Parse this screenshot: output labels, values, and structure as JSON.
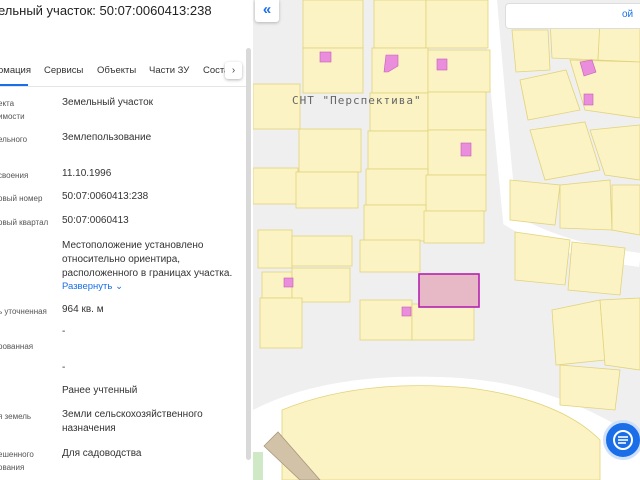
{
  "panel": {
    "title": "ельный участок: 50:07:0060413:238",
    "tabs": [
      {
        "label": "омация"
      },
      {
        "label": "Сервисы"
      },
      {
        "label": "Объекты"
      },
      {
        "label": "Части ЗУ"
      },
      {
        "label": "Соста"
      }
    ],
    "next_icon": "chevron-right-icon",
    "rows": [
      {
        "label": [
          "екта",
          "имости"
        ],
        "value": "Земельный участок"
      },
      {
        "label": [
          "ельного"
        ],
        "value": "Землепользование"
      },
      {
        "label": [
          "своения"
        ],
        "value": "11.10.1996"
      },
      {
        "label": [
          "овый номер"
        ],
        "value": "50:07:0060413:238"
      },
      {
        "label": [
          "овый квартал"
        ],
        "value": "50:07:0060413"
      },
      {
        "label": [],
        "value": "Местоположение установлено относительно ориентира, расположенного в границах участка."
      },
      {
        "label": [
          "ь уточненная"
        ],
        "value": "964 кв. м"
      },
      {
        "label": [
          "",
          "рованная"
        ],
        "value": "-"
      },
      {
        "label": [
          ""
        ],
        "value": "-"
      },
      {
        "label": [],
        "value": "Ранее учтенный"
      },
      {
        "label": [
          "я земель"
        ],
        "value": "Земли сельскохозяйственного назначения"
      },
      {
        "label": [
          "ешенного",
          "ования"
        ],
        "value": "Для садоводства"
      }
    ],
    "expand_link": "Развернуть"
  },
  "map": {
    "label": "СНТ \"Перспектива\"",
    "search_text": "ой",
    "collapse_icon": "double-chevron-left-icon",
    "chat_icon": "chat-icon",
    "colors": {
      "plot": "#fbf3c4",
      "plot_border": "#e2d37a",
      "building": "#e98ddc",
      "selected": "#e7b8c6",
      "selected_border": "#b522b0"
    }
  }
}
